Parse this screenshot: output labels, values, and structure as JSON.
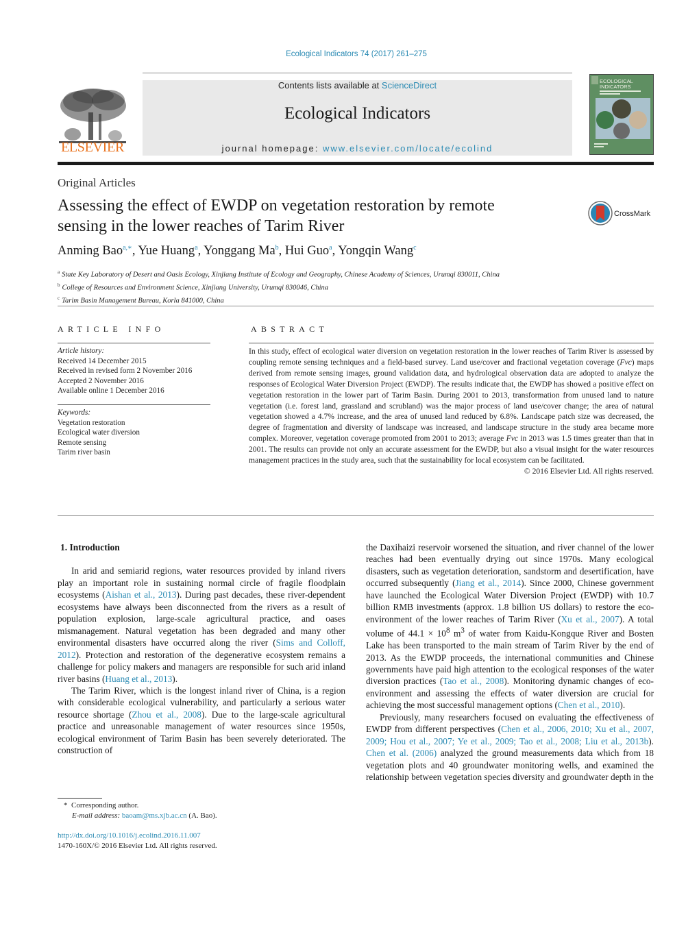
{
  "header": {
    "journal_reference": "Ecological Indicators 74 (2017) 261–275",
    "contents_prefix": "Contents lists available at ",
    "contents_link": "ScienceDirect",
    "journal_title": "Ecological Indicators",
    "homepage_prefix": "journal homepage: ",
    "homepage_link": "www.elsevier.com/locate/ecolind",
    "publisher_logo_text": "ELSEVIER",
    "cover_title_line1": "ECOLOGICAL",
    "cover_title_line2": "INDICATORS",
    "colors": {
      "link": "#2a8ab3",
      "elsevier_orange": "#e9711c",
      "banner_bg": "#e9e9e9"
    }
  },
  "article": {
    "section_type": "Original Articles",
    "title_line1": "Assessing the effect of EWDP on vegetation restoration by remote",
    "title_line2": "sensing in the lower reaches of Tarim River",
    "crossmark_label": "CrossMark",
    "authors": [
      {
        "name": "Anming Bao",
        "sup": "a,∗"
      },
      {
        "name": "Yue Huang",
        "sup": "a"
      },
      {
        "name": "Yonggang Ma",
        "sup": "b"
      },
      {
        "name": "Hui Guo",
        "sup": "a"
      },
      {
        "name": "Yongqin Wang",
        "sup": "c"
      }
    ],
    "affiliations": [
      {
        "key": "a",
        "text": "State Key Laboratory of Desert and Oasis Ecology, Xinjiang Institute of Ecology and Geography, Chinese Academy of Sciences, Urumqi 830011, China"
      },
      {
        "key": "b",
        "text": "College of Resources and Environment Science, Xinjiang University, Urumqi 830046, China"
      },
      {
        "key": "c",
        "text": "Tarim Basin Management Bureau, Korla 841000, China"
      }
    ]
  },
  "article_info": {
    "heading": "ARTICLE INFO",
    "history_label": "Article history:",
    "history": [
      "Received 14 December 2015",
      "Received in revised form 2 November 2016",
      "Accepted 2 November 2016",
      "Available online 1 December 2016"
    ],
    "keywords_label": "Keywords:",
    "keywords": [
      "Vegetation restoration",
      "Ecological water diversion",
      "Remote sensing",
      "Tarim river basin"
    ]
  },
  "abstract": {
    "heading": "ABSTRACT",
    "text_1": "In this study, effect of ecological water diversion on vegetation restoration in the lower reaches of Tarim River is assessed by coupling remote sensing techniques and a field-based survey. Land use/cover and fractional vegetation coverage (",
    "fvc": "Fvc",
    "text_2": ") maps derived from remote sensing images, ground validation data, and hydrological observation data are adopted to analyze the responses of Ecological Water Diversion Project (EWDP). The results indicate that, the EWDP has showed a positive effect on vegetation restoration in the lower part of Tarim Basin. During 2001 to 2013, transformation from unused land to nature vegetation (i.e. forest land, grassland and scrubland) was the major process of land use/cover change; the area of natural vegetation showed a 4.7% increase, and the area of unused land reduced by 6.8%. Landscape patch size was decreased, the degree of fragmentation and diversity of landscape was increased, and landscape structure in the study area became more complex. Moreover, vegetation coverage promoted from 2001 to 2013; average ",
    "text_3": " in 2013 was 1.5 times greater than that in 2001. The results can provide not only an accurate assessment for the EWDP, but also a visual insight for the water resources management practices in the study area, such that the sustainability for local ecosystem can be facilitated.",
    "copyright": "© 2016 Elsevier Ltd. All rights reserved."
  },
  "introduction": {
    "heading": "1.  Introduction",
    "p1": [
      "In arid and semiarid regions, water resources provided by inland rivers play an important role in sustaining normal circle of fragile floodplain ecosystems (",
      "Aishan et al., 2013",
      "). During past decades, these river-dependent ecosystems have always been disconnected from the rivers as a result of population explosion, large-scale agricultural practice, and oases mismanagement. Natural vegetation has been degraded and many other environmental disasters have occurred along the river (",
      "Sims and Colloff, 2012",
      "). Protection and restoration of the degenerative ecosystem remains a challenge for policy makers and managers are responsible for such arid inland river basins (",
      "Huang et al., 2013",
      ")."
    ],
    "p2": [
      "The Tarim River, which is the longest inland river of China, is a region with considerable ecological vulnerability, and particularly a serious water resource shortage (",
      "Zhou et al., 2008",
      "). Due to the large-scale agricultural practice and unreasonable management of water resources since 1950s, ecological environment of Tarim Basin has been severely deteriorated. The construction of the Daxihaizi reservoir worsened the situation, and river channel of the lower reaches had been eventually drying out since 1970s. Many ecological disasters, such as vegetation deterioration, sandstorm and desertification, have occurred subsequently (",
      "Jiang et al., 2014",
      "). Since 2000, Chinese government have launched the Ecological Water Diversion Project (EWDP) with 10.7 billion RMB investments (approx. 1.8 billion US dollars) to restore the eco-environment of the lower reaches of Tarim River (",
      "Xu et al., 2007",
      "). A total volume of 44.1 × 10",
      "8",
      " m",
      "3",
      " of water from Kaidu-Kongque River and Bosten Lake has been transported to the main stream of Tarim River by the end of 2013. As the EWDP proceeds, the international communities and Chinese governments have paid high attention to the ecological responses of the water diversion practices (",
      "Tao et al., 2008",
      "). Monitoring dynamic changes of eco-environment and assessing the effects of water diversion are crucial for achieving the most successful management options (",
      "Chen et al., 2010",
      ")."
    ],
    "p3": [
      "Previously, many researchers focused on evaluating the effectiveness of EWDP from different perspectives (",
      "Chen et al., 2006, 2010; Xu et al., 2007, 2009; Hou et al., 2007; Ye et al., 2009; Tao et al., 2008; Liu et al., 2013b",
      "). ",
      "Chen et al. (2006)",
      " analyzed the ground measurements data which from 18 vegetation plots and 40 groundwater monitoring wells, and examined the relationship between vegetation species diversity and groundwater depth in the"
    ]
  },
  "footnotes": {
    "marker": "*",
    "corresponding": "Corresponding author.",
    "email_label": "E-mail address:",
    "email": "baoam@ms.xjb.ac.cn",
    "email_suffix": " (A. Bao).",
    "doi": "http://dx.doi.org/10.1016/j.ecolind.2016.11.007",
    "issn_line": "1470-160X/© 2016 Elsevier Ltd. All rights reserved."
  }
}
